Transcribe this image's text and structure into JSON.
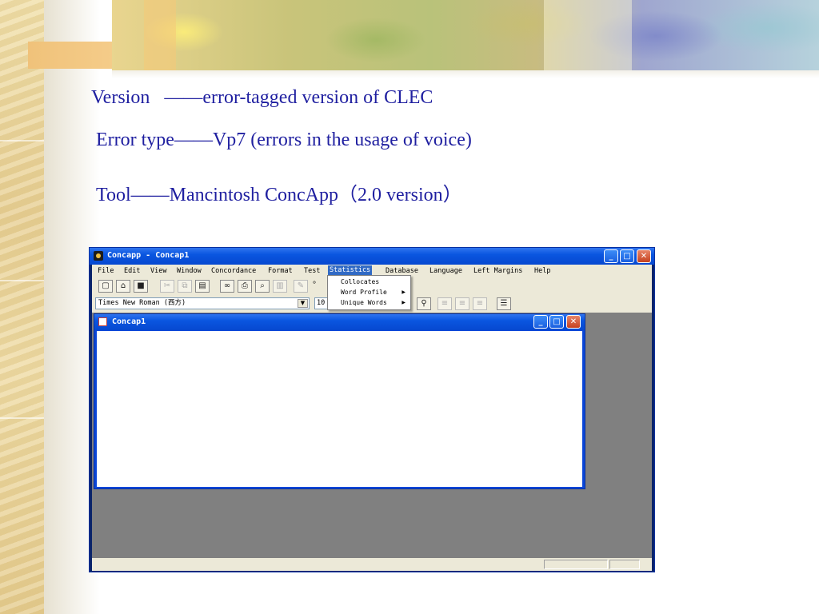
{
  "slide": {
    "line1": "Version   ——error-tagged version of CLEC",
    "line2": "Error type——Vp7 (errors in the usage of voice)",
    "line3": "Tool——Mancintosh ConcApp（2.0 version）"
  },
  "colors": {
    "slide_text": "#1f1fa0",
    "titlebar": "#0a56e0",
    "menu_highlight": "#316ac5",
    "mdi_background": "#808080"
  },
  "app": {
    "title": "Concapp - Concap1",
    "menu": [
      "File",
      "Edit",
      "View",
      "Window",
      "Concordance",
      "Format",
      "Test",
      "Statistics",
      "Database",
      "Language",
      "Left Margins",
      "Help"
    ],
    "active_menu": "Statistics",
    "font_name": "Times New Roman (西方)",
    "font_size": "10",
    "toolbar_icons": [
      "new-file-icon",
      "open-folder-icon",
      "save-icon",
      "cut-icon",
      "copy-icon",
      "paste-icon",
      "find-icon",
      "print-icon",
      "print-preview-icon",
      "highlight-icon",
      "pen-icon",
      "search-tool-icon",
      "align-left-icon",
      "align-center-icon",
      "align-right-icon",
      "bullet-list-icon"
    ]
  },
  "statistics_menu": {
    "items": [
      {
        "label": "Collocates",
        "has_submenu": false
      },
      {
        "label": "Word Profile",
        "has_submenu": true
      },
      {
        "label": "Unique Words",
        "has_submenu": true
      }
    ]
  },
  "child_window": {
    "title": "Concap1"
  }
}
